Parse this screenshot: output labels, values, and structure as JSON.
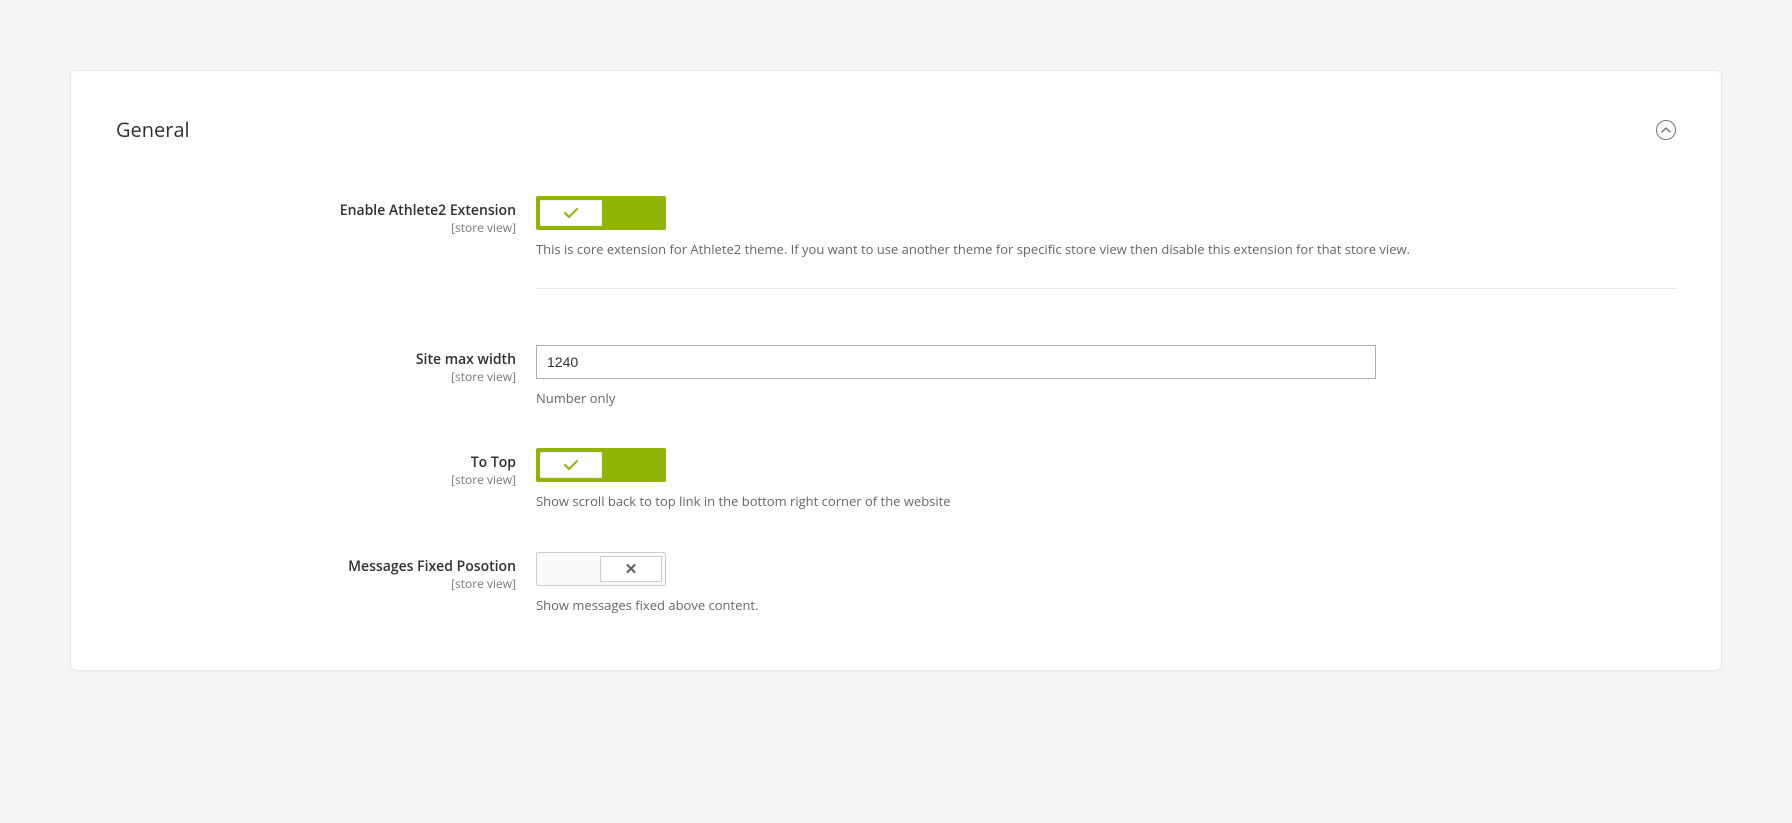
{
  "section": {
    "title": "General"
  },
  "fields": {
    "enable": {
      "label": "Enable Athlete2 Extension",
      "scope": "[store view]",
      "help": "This is core extension for Athlete2 theme. If you want to use another theme for specific store view then disable this extension for that store view."
    },
    "maxwidth": {
      "label": "Site max width",
      "scope": "[store view]",
      "value": "1240",
      "help": "Number only"
    },
    "totop": {
      "label": "To Top",
      "scope": "[store view]",
      "help": "Show scroll back to top link in the bottom right corner of the website"
    },
    "messages": {
      "label": "Messages Fixed Posotion",
      "scope": "[store view]",
      "help": "Show messages fixed above content."
    }
  }
}
